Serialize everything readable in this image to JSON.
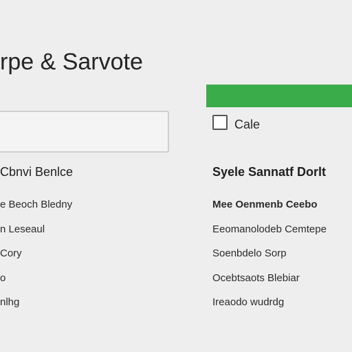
{
  "page": {
    "title": "rpe & Sarvote"
  },
  "form": {
    "text_field_value": ""
  },
  "checkbox": {
    "label": "Cale",
    "checked": false
  },
  "colors": {
    "accent_bar": "#3aac4a",
    "background": "#eeeeee",
    "field_border": "#cfcfcf"
  },
  "left_panel": {
    "heading": "Cbnvi Benlce",
    "items": [
      "e  Beoch  Bledny",
      "n  Leseaul",
      "Cory",
      "o",
      "nlhg"
    ]
  },
  "right_panel": {
    "heading": "Syele Sannatf Dorlt",
    "items": [
      "Mee  Oenmenb  Ceebo",
      "Eeomanolodeb  Cemtepe",
      "Soenbdelo  Sorp",
      "Ocebtsaots  Blebiar",
      "Ireaodo  wudrdg"
    ]
  }
}
